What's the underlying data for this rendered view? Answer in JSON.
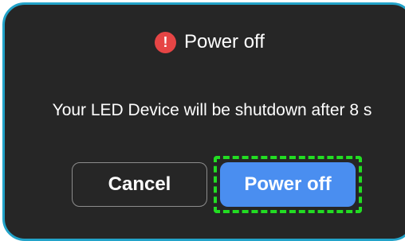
{
  "dialog": {
    "icon": "exclamation-icon",
    "icon_glyph": "!",
    "title": "Power off",
    "message": "Your LED Device will be shutdown after 8 s",
    "cancel_label": "Cancel",
    "confirm_label": "Power off"
  },
  "colors": {
    "background": "#262626",
    "border": "#22a3c9",
    "alert_icon": "#e64545",
    "primary_button": "#4a8ef0",
    "focus_highlight": "#22dd22"
  }
}
